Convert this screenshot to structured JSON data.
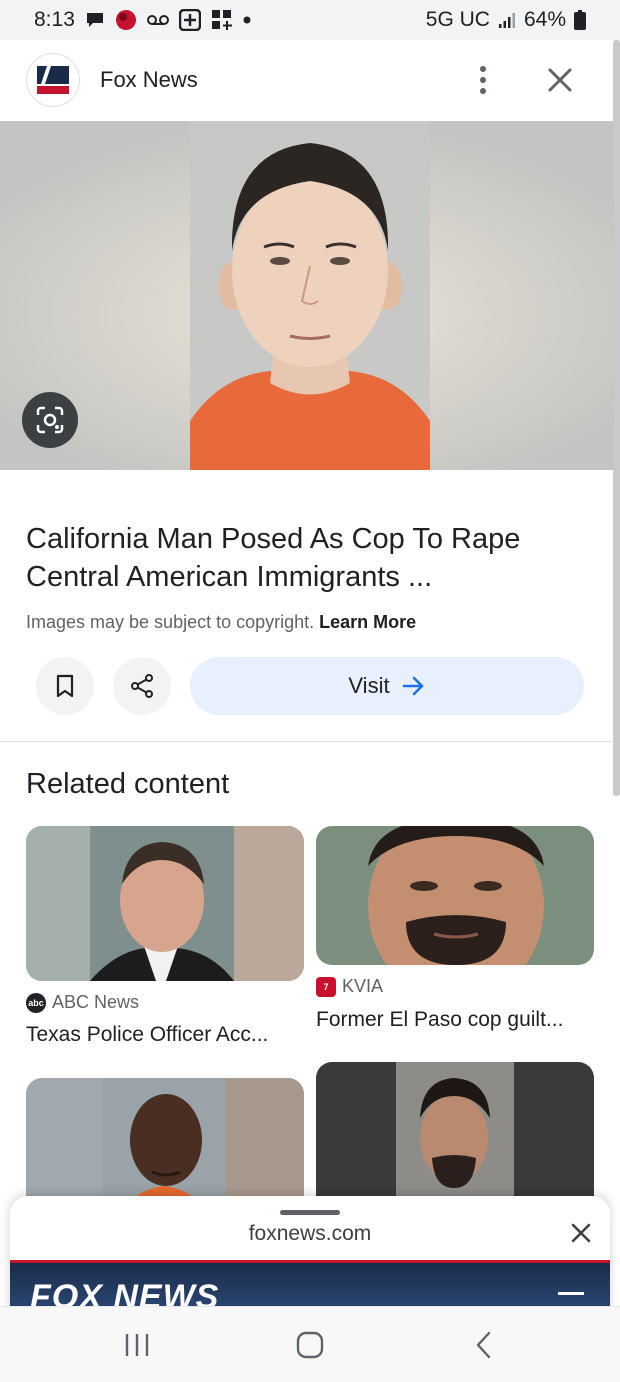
{
  "status_bar": {
    "time": "8:13",
    "network": "5G UC",
    "battery": "64%"
  },
  "header": {
    "site_name": "Fox News",
    "logo_icon": "fox-news-logo-icon",
    "more_icon": "more-vert-icon",
    "close_icon": "close-icon"
  },
  "result": {
    "title": "California Man Posed As Cop To Rape Central American Immigrants ...",
    "copyright_text": "Images may be subject to copyright.",
    "learn_more": "Learn More",
    "visit_label": "Visit"
  },
  "related": {
    "heading": "Related content",
    "cards": [
      {
        "source": "ABC News",
        "source_logo_text": "abc",
        "source_color": "#202124",
        "title": "Texas Police Officer Acc..."
      },
      {
        "source": "KVIA",
        "source_logo_text": "7",
        "source_color": "#c8102e",
        "title": "Former El Paso cop guilt..."
      }
    ]
  },
  "sheet": {
    "domain": "foxnews.com",
    "banner_text": "FOX NEWS"
  },
  "colors": {
    "accent": "#1a73e8",
    "visit_bg": "#e8f0fe",
    "fox_red": "#c4122f",
    "fox_navy": "#1a2b4a"
  }
}
